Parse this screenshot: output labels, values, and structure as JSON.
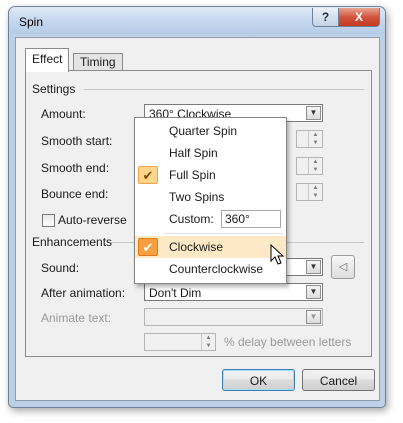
{
  "window": {
    "title": "Spin",
    "help_label": "?",
    "close_label": "X"
  },
  "tabs": [
    {
      "label": "Effect"
    },
    {
      "label": "Timing"
    }
  ],
  "settings": {
    "heading": "Settings",
    "amount_label": "Amount:",
    "amount_value": "360° Clockwise",
    "smooth_start_label": "Smooth start:",
    "smooth_end_label": "Smooth end:",
    "bounce_end_label": "Bounce end:",
    "auto_reverse_label": "Auto-reverse"
  },
  "enhancements": {
    "heading": "Enhancements",
    "sound_label": "Sound:",
    "after_animation_label": "After animation:",
    "after_animation_value": "Don't Dim",
    "animate_text_label": "Animate text:",
    "delay_label": "% delay between letters"
  },
  "dropdown": {
    "items": [
      {
        "label": "Quarter Spin",
        "checked": false
      },
      {
        "label": "Half Spin",
        "checked": false
      },
      {
        "label": "Full Spin",
        "checked": true
      },
      {
        "label": "Two Spins",
        "checked": false
      },
      {
        "label": "Custom:",
        "checked": false,
        "value": "360°"
      },
      {
        "label": "Clockwise",
        "checked": true,
        "highlighted": true
      },
      {
        "label": "Counterclockwise",
        "checked": false
      }
    ],
    "check_glyph": "✔"
  },
  "buttons": {
    "ok_label": "OK",
    "cancel_label": "Cancel"
  },
  "colors": {
    "highlight": "#fde9c6",
    "check_accent": "#f6a041"
  }
}
